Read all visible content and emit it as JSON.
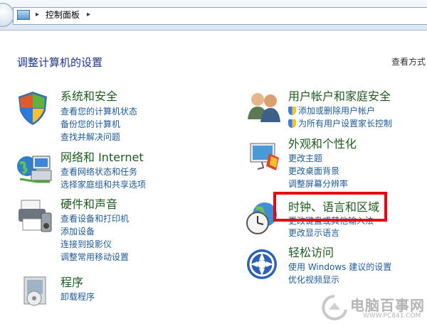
{
  "address_bar": {
    "breadcrumb": "控制面板",
    "separator": "▸"
  },
  "page": {
    "heading": "调整计算机的设置",
    "view_by": "查看方式"
  },
  "categories": [
    {
      "title": "系统和安全",
      "icon": "system-security-icon",
      "links": [
        {
          "text": "查看您的计算机状态",
          "shield": false
        },
        {
          "text": "备份您的计算机",
          "shield": false
        },
        {
          "text": "查找并解决问题",
          "shield": false
        }
      ]
    },
    {
      "title": "网络和 Internet",
      "icon": "network-icon",
      "links": [
        {
          "text": "查看网络状态和任务",
          "shield": false
        },
        {
          "text": "选择家庭组和共享选项",
          "shield": false
        }
      ]
    },
    {
      "title": "硬件和声音",
      "icon": "printer-icon",
      "links": [
        {
          "text": "查看设备和打印机",
          "shield": false
        },
        {
          "text": "添加设备",
          "shield": false
        },
        {
          "text": "连接到投影仪",
          "shield": false
        },
        {
          "text": "调整常用移动设置",
          "shield": false
        }
      ]
    },
    {
      "title": "程序",
      "icon": "programs-icon",
      "links": [
        {
          "text": "卸载程序",
          "shield": false
        }
      ]
    },
    {
      "title": "用户帐户和家庭安全",
      "icon": "user-accounts-icon",
      "links": [
        {
          "text": "添加或删除用户帐户",
          "shield": true
        },
        {
          "text": "为所有用户设置家长控制",
          "shield": true
        }
      ]
    },
    {
      "title": "外观和个性化",
      "icon": "appearance-icon",
      "links": [
        {
          "text": "更改主题",
          "shield": false
        },
        {
          "text": "更改桌面背景",
          "shield": false
        },
        {
          "text": "调整屏幕分辨率",
          "shield": false
        }
      ]
    },
    {
      "title": "时钟、语言和区域",
      "icon": "clock-globe-icon",
      "links": [
        {
          "text": "更改键盘或其他输入法",
          "shield": false
        },
        {
          "text": "更改显示语言",
          "shield": false
        }
      ]
    },
    {
      "title": "轻松访问",
      "icon": "ease-of-access-icon",
      "links": [
        {
          "text": "使用 Windows 建议的设置",
          "shield": false
        },
        {
          "text": "优化视频显示",
          "shield": false
        }
      ]
    }
  ],
  "watermark": {
    "text": "电脑百事网",
    "sub": "WWW.PC841.COM"
  },
  "colors": {
    "category_title": "#1e5a1e",
    "link": "#1e5a96",
    "heading": "#1e3287",
    "highlight_box": "#e60012"
  }
}
